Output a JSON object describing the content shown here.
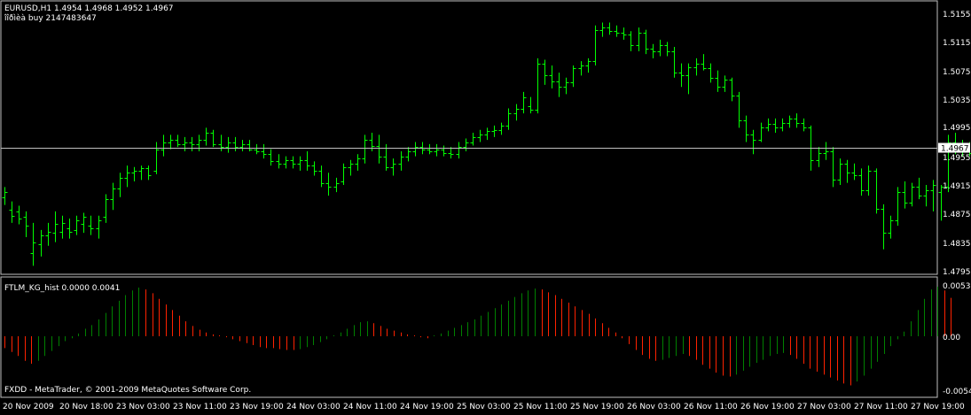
{
  "main_chart": {
    "header": "EURUSD,H1  1.4954 1.4968 1.4952 1.4967",
    "sub_header": "îîðìèà buy 2147483647",
    "current_price": "1.4967",
    "price_axis": [
      "1.5155",
      "1.5115",
      "1.5075",
      "1.5035",
      "1.4995",
      "1.4955",
      "1.4915",
      "1.4875",
      "1.4835",
      "1.4795"
    ]
  },
  "indicator": {
    "header": "FTLM_KG_hist 0.0000 0.0041",
    "axis": [
      "0.0053",
      "0.00",
      "-0.0054"
    ]
  },
  "time_axis": [
    "20 Nov 2009",
    "20 Nov 18:00",
    "23 Nov 03:00",
    "23 Nov 11:00",
    "23 Nov 19:00",
    "24 Nov 03:00",
    "24 Nov 11:00",
    "24 Nov 19:00",
    "25 Nov 03:00",
    "25 Nov 11:00",
    "25 Nov 19:00",
    "26 Nov 03:00",
    "26 Nov 11:00",
    "26 Nov 19:00",
    "27 Nov 03:00",
    "27 Nov 11:00",
    "27 Nov 19:00"
  ],
  "copyright": "FXDD - MetaTrader, © 2001-2009 MetaQuotes Software Corp.",
  "colors": {
    "bull": "#00ff00",
    "bear": "#ff0000",
    "hist_up": "#008000",
    "hist_down": "#ff2200",
    "frame": "#c0c0c0",
    "price_line": "#c0c0c0"
  },
  "chart_data": {
    "type": "candlestick_ohlc",
    "symbol": "EURUSD",
    "timeframe": "H1",
    "price_range": [
      1.478,
      1.517
    ],
    "bars": [
      {
        "o": 1.4898,
        "h": 1.4912,
        "l": 1.4887,
        "c": 1.4905
      },
      {
        "o": 1.488,
        "h": 1.4892,
        "l": 1.4862,
        "c": 1.4872
      },
      {
        "o": 1.4878,
        "h": 1.4886,
        "l": 1.486,
        "c": 1.4868
      },
      {
        "o": 1.487,
        "h": 1.4878,
        "l": 1.4842,
        "c": 1.4858
      },
      {
        "o": 1.482,
        "h": 1.4862,
        "l": 1.4802,
        "c": 1.4835
      },
      {
        "o": 1.4832,
        "h": 1.4852,
        "l": 1.4815,
        "c": 1.4845
      },
      {
        "o": 1.4845,
        "h": 1.4862,
        "l": 1.483,
        "c": 1.485
      },
      {
        "o": 1.4848,
        "h": 1.4878,
        "l": 1.4835,
        "c": 1.486
      },
      {
        "o": 1.485,
        "h": 1.4872,
        "l": 1.484,
        "c": 1.4862
      },
      {
        "o": 1.4855,
        "h": 1.4868,
        "l": 1.484,
        "c": 1.485
      },
      {
        "o": 1.4852,
        "h": 1.4872,
        "l": 1.4845,
        "c": 1.4865
      },
      {
        "o": 1.486,
        "h": 1.4876,
        "l": 1.4848,
        "c": 1.487
      },
      {
        "o": 1.4858,
        "h": 1.4872,
        "l": 1.4845,
        "c": 1.4855
      },
      {
        "o": 1.4855,
        "h": 1.4872,
        "l": 1.484,
        "c": 1.4865
      },
      {
        "o": 1.487,
        "h": 1.4902,
        "l": 1.4862,
        "c": 1.4895
      },
      {
        "o": 1.4895,
        "h": 1.4918,
        "l": 1.488,
        "c": 1.491
      },
      {
        "o": 1.491,
        "h": 1.4932,
        "l": 1.4898,
        "c": 1.4925
      },
      {
        "o": 1.4925,
        "h": 1.4942,
        "l": 1.4912,
        "c": 1.4932
      },
      {
        "o": 1.4932,
        "h": 1.494,
        "l": 1.492,
        "c": 1.4935
      },
      {
        "o": 1.4935,
        "h": 1.4942,
        "l": 1.4922,
        "c": 1.4938
      },
      {
        "o": 1.4938,
        "h": 1.4942,
        "l": 1.4922,
        "c": 1.4928
      },
      {
        "o": 1.4935,
        "h": 1.4975,
        "l": 1.493,
        "c": 1.4965
      },
      {
        "o": 1.4965,
        "h": 1.4985,
        "l": 1.4955,
        "c": 1.4975
      },
      {
        "o": 1.4975,
        "h": 1.4985,
        "l": 1.4965,
        "c": 1.4978
      },
      {
        "o": 1.4978,
        "h": 1.4985,
        "l": 1.4968,
        "c": 1.4972
      },
      {
        "o": 1.4972,
        "h": 1.4982,
        "l": 1.4962,
        "c": 1.4975
      },
      {
        "o": 1.4975,
        "h": 1.4982,
        "l": 1.4962,
        "c": 1.4972
      },
      {
        "o": 1.4972,
        "h": 1.4985,
        "l": 1.4962,
        "c": 1.4978
      },
      {
        "o": 1.4978,
        "h": 1.4995,
        "l": 1.497,
        "c": 1.4988
      },
      {
        "o": 1.4988,
        "h": 1.4992,
        "l": 1.4968,
        "c": 1.4972
      },
      {
        "o": 1.4972,
        "h": 1.4985,
        "l": 1.4962,
        "c": 1.4968
      },
      {
        "o": 1.4968,
        "h": 1.4982,
        "l": 1.496,
        "c": 1.4975
      },
      {
        "o": 1.4975,
        "h": 1.4982,
        "l": 1.4962,
        "c": 1.4968
      },
      {
        "o": 1.4968,
        "h": 1.4978,
        "l": 1.4962,
        "c": 1.4972
      },
      {
        "o": 1.4972,
        "h": 1.4978,
        "l": 1.4962,
        "c": 1.4965
      },
      {
        "o": 1.4965,
        "h": 1.4972,
        "l": 1.4958,
        "c": 1.4962
      },
      {
        "o": 1.4962,
        "h": 1.4972,
        "l": 1.4952,
        "c": 1.4958
      },
      {
        "o": 1.4958,
        "h": 1.4965,
        "l": 1.4942,
        "c": 1.4948
      },
      {
        "o": 1.4948,
        "h": 1.4958,
        "l": 1.4938,
        "c": 1.4945
      },
      {
        "o": 1.4945,
        "h": 1.4955,
        "l": 1.4938,
        "c": 1.495
      },
      {
        "o": 1.495,
        "h": 1.4955,
        "l": 1.4938,
        "c": 1.4945
      },
      {
        "o": 1.4945,
        "h": 1.4955,
        "l": 1.4935,
        "c": 1.495
      },
      {
        "o": 1.495,
        "h": 1.4962,
        "l": 1.4935,
        "c": 1.4942
      },
      {
        "o": 1.4942,
        "h": 1.4948,
        "l": 1.4928,
        "c": 1.4935
      },
      {
        "o": 1.4935,
        "h": 1.4942,
        "l": 1.4912,
        "c": 1.4918
      },
      {
        "o": 1.4918,
        "h": 1.4932,
        "l": 1.49,
        "c": 1.4912
      },
      {
        "o": 1.4912,
        "h": 1.4925,
        "l": 1.4905,
        "c": 1.4918
      },
      {
        "o": 1.492,
        "h": 1.4945,
        "l": 1.4915,
        "c": 1.494
      },
      {
        "o": 1.494,
        "h": 1.495,
        "l": 1.4928,
        "c": 1.4945
      },
      {
        "o": 1.4945,
        "h": 1.4958,
        "l": 1.4935,
        "c": 1.4952
      },
      {
        "o": 1.4952,
        "h": 1.4985,
        "l": 1.4945,
        "c": 1.4978
      },
      {
        "o": 1.4978,
        "h": 1.4988,
        "l": 1.4962,
        "c": 1.497
      },
      {
        "o": 1.497,
        "h": 1.4985,
        "l": 1.4945,
        "c": 1.4955
      },
      {
        "o": 1.4955,
        "h": 1.4972,
        "l": 1.4935,
        "c": 1.494
      },
      {
        "o": 1.494,
        "h": 1.4952,
        "l": 1.4928,
        "c": 1.4945
      },
      {
        "o": 1.4945,
        "h": 1.4962,
        "l": 1.4935,
        "c": 1.4955
      },
      {
        "o": 1.4955,
        "h": 1.4968,
        "l": 1.4948,
        "c": 1.4962
      },
      {
        "o": 1.4962,
        "h": 1.4975,
        "l": 1.4955,
        "c": 1.4968
      },
      {
        "o": 1.4968,
        "h": 1.4975,
        "l": 1.4958,
        "c": 1.4965
      },
      {
        "o": 1.4965,
        "h": 1.4972,
        "l": 1.4958,
        "c": 1.4962
      },
      {
        "o": 1.4962,
        "h": 1.4972,
        "l": 1.4955,
        "c": 1.4965
      },
      {
        "o": 1.4965,
        "h": 1.497,
        "l": 1.4955,
        "c": 1.496
      },
      {
        "o": 1.496,
        "h": 1.4968,
        "l": 1.4952,
        "c": 1.4958
      },
      {
        "o": 1.4958,
        "h": 1.4975,
        "l": 1.4952,
        "c": 1.4968
      },
      {
        "o": 1.4968,
        "h": 1.498,
        "l": 1.4962,
        "c": 1.4975
      },
      {
        "o": 1.4975,
        "h": 1.4988,
        "l": 1.497,
        "c": 1.4982
      },
      {
        "o": 1.4982,
        "h": 1.4992,
        "l": 1.4975,
        "c": 1.4985
      },
      {
        "o": 1.4985,
        "h": 1.4995,
        "l": 1.4978,
        "c": 1.499
      },
      {
        "o": 1.499,
        "h": 1.4998,
        "l": 1.4982,
        "c": 1.4992
      },
      {
        "o": 1.4992,
        "h": 1.5002,
        "l": 1.4985,
        "c": 1.4998
      },
      {
        "o": 1.4998,
        "h": 1.5022,
        "l": 1.4992,
        "c": 1.5015
      },
      {
        "o": 1.5015,
        "h": 1.5028,
        "l": 1.5005,
        "c": 1.5022
      },
      {
        "o": 1.5022,
        "h": 1.5045,
        "l": 1.5015,
        "c": 1.5038
      },
      {
        "o": 1.5025,
        "h": 1.5038,
        "l": 1.5015,
        "c": 1.502
      },
      {
        "o": 1.502,
        "h": 1.5092,
        "l": 1.5015,
        "c": 1.5085
      },
      {
        "o": 1.5085,
        "h": 1.509,
        "l": 1.5055,
        "c": 1.5068
      },
      {
        "o": 1.5068,
        "h": 1.5082,
        "l": 1.505,
        "c": 1.506
      },
      {
        "o": 1.506,
        "h": 1.5072,
        "l": 1.5038,
        "c": 1.5052
      },
      {
        "o": 1.5052,
        "h": 1.5065,
        "l": 1.5042,
        "c": 1.5058
      },
      {
        "o": 1.5058,
        "h": 1.5082,
        "l": 1.5052,
        "c": 1.5078
      },
      {
        "o": 1.5078,
        "h": 1.5088,
        "l": 1.5068,
        "c": 1.5082
      },
      {
        "o": 1.5082,
        "h": 1.5092,
        "l": 1.5072,
        "c": 1.5088
      },
      {
        "o": 1.5088,
        "h": 1.5138,
        "l": 1.5082,
        "c": 1.5132
      },
      {
        "o": 1.5132,
        "h": 1.5142,
        "l": 1.5122,
        "c": 1.5135
      },
      {
        "o": 1.5135,
        "h": 1.5142,
        "l": 1.5125,
        "c": 1.513
      },
      {
        "o": 1.513,
        "h": 1.5138,
        "l": 1.5122,
        "c": 1.5128
      },
      {
        "o": 1.5128,
        "h": 1.5135,
        "l": 1.5118,
        "c": 1.5125
      },
      {
        "o": 1.5125,
        "h": 1.513,
        "l": 1.5102,
        "c": 1.511
      },
      {
        "o": 1.511,
        "h": 1.5135,
        "l": 1.5102,
        "c": 1.5128
      },
      {
        "o": 1.5128,
        "h": 1.5132,
        "l": 1.5098,
        "c": 1.5105
      },
      {
        "o": 1.5105,
        "h": 1.5112,
        "l": 1.5092,
        "c": 1.5102
      },
      {
        "o": 1.5102,
        "h": 1.5118,
        "l": 1.5095,
        "c": 1.511
      },
      {
        "o": 1.511,
        "h": 1.5115,
        "l": 1.5095,
        "c": 1.5102
      },
      {
        "o": 1.5102,
        "h": 1.5108,
        "l": 1.5065,
        "c": 1.5072
      },
      {
        "o": 1.5072,
        "h": 1.5085,
        "l": 1.5052,
        "c": 1.5068
      },
      {
        "o": 1.5068,
        "h": 1.5085,
        "l": 1.5042,
        "c": 1.508
      },
      {
        "o": 1.508,
        "h": 1.5092,
        "l": 1.5068,
        "c": 1.5085
      },
      {
        "o": 1.5085,
        "h": 1.5098,
        "l": 1.5075,
        "c": 1.5078
      },
      {
        "o": 1.5078,
        "h": 1.5085,
        "l": 1.5058,
        "c": 1.5065
      },
      {
        "o": 1.5065,
        "h": 1.5075,
        "l": 1.5045,
        "c": 1.5052
      },
      {
        "o": 1.5052,
        "h": 1.5068,
        "l": 1.5045,
        "c": 1.5062
      },
      {
        "o": 1.5062,
        "h": 1.5065,
        "l": 1.5032,
        "c": 1.504
      },
      {
        "o": 1.504,
        "h": 1.5045,
        "l": 1.4995,
        "c": 1.5005
      },
      {
        "o": 1.5005,
        "h": 1.5012,
        "l": 1.4975,
        "c": 1.4985
      },
      {
        "o": 1.4985,
        "h": 1.4992,
        "l": 1.4958,
        "c": 1.4978
      },
      {
        "o": 1.4978,
        "h": 1.5002,
        "l": 1.4975,
        "c": 1.4995
      },
      {
        "o": 1.4995,
        "h": 1.5008,
        "l": 1.499,
        "c": 1.5
      },
      {
        "o": 1.5,
        "h": 1.5008,
        "l": 1.4988,
        "c": 1.4995
      },
      {
        "o": 1.4995,
        "h": 1.5008,
        "l": 1.499,
        "c": 1.5002
      },
      {
        "o": 1.5002,
        "h": 1.5012,
        "l": 1.4995,
        "c": 1.5008
      },
      {
        "o": 1.5008,
        "h": 1.5015,
        "l": 1.4995,
        "c": 1.5002
      },
      {
        "o": 1.5002,
        "h": 1.5008,
        "l": 1.499,
        "c": 1.4995
      },
      {
        "o": 1.4995,
        "h": 1.4998,
        "l": 1.4935,
        "c": 1.495
      },
      {
        "o": 1.495,
        "h": 1.4968,
        "l": 1.494,
        "c": 1.496
      },
      {
        "o": 1.496,
        "h": 1.4975,
        "l": 1.495,
        "c": 1.4962
      },
      {
        "o": 1.4962,
        "h": 1.4968,
        "l": 1.4912,
        "c": 1.4922
      },
      {
        "o": 1.4922,
        "h": 1.4952,
        "l": 1.4915,
        "c": 1.4945
      },
      {
        "o": 1.4945,
        "h": 1.495,
        "l": 1.4918,
        "c": 1.4932
      },
      {
        "o": 1.4932,
        "h": 1.4945,
        "l": 1.4922,
        "c": 1.4928
      },
      {
        "o": 1.4928,
        "h": 1.4938,
        "l": 1.49,
        "c": 1.4908
      },
      {
        "o": 1.4908,
        "h": 1.4942,
        "l": 1.49,
        "c": 1.4935
      },
      {
        "o": 1.4935,
        "h": 1.4938,
        "l": 1.4875,
        "c": 1.4882
      },
      {
        "o": 1.4882,
        "h": 1.4888,
        "l": 1.4825,
        "c": 1.4848
      },
      {
        "o": 1.4848,
        "h": 1.4872,
        "l": 1.484,
        "c": 1.4865
      },
      {
        "o": 1.4865,
        "h": 1.4912,
        "l": 1.4858,
        "c": 1.4905
      },
      {
        "o": 1.4905,
        "h": 1.492,
        "l": 1.4882,
        "c": 1.489
      },
      {
        "o": 1.489,
        "h": 1.4918,
        "l": 1.4885,
        "c": 1.4912
      },
      {
        "o": 1.4912,
        "h": 1.4925,
        "l": 1.4895,
        "c": 1.49
      },
      {
        "o": 1.49,
        "h": 1.4915,
        "l": 1.4885,
        "c": 1.4908
      },
      {
        "o": 1.4908,
        "h": 1.4922,
        "l": 1.4878,
        "c": 1.4915
      },
      {
        "o": 1.4905,
        "h": 1.4915,
        "l": 1.4865,
        "c": 1.4912
      },
      {
        "o": 1.4912,
        "h": 1.4985,
        "l": 1.4905,
        "c": 1.4975
      },
      {
        "o": 1.4975,
        "h": 1.4988,
        "l": 1.4958,
        "c": 1.4962
      },
      {
        "o": 1.4962,
        "h": 1.4978,
        "l": 1.4955,
        "c": 1.4968
      },
      {
        "o": 1.4968,
        "h": 1.4975,
        "l": 1.4955,
        "c": 1.496
      },
      {
        "o": 1.496,
        "h": 1.4968,
        "l": 1.495,
        "c": 1.4958
      },
      {
        "o": 1.4954,
        "h": 1.4968,
        "l": 1.4952,
        "c": 1.4967
      }
    ],
    "histogram": {
      "range": [
        -0.0054,
        0.0053
      ],
      "values": [
        -0.0012,
        -0.0016,
        -0.002,
        -0.0025,
        -0.0028,
        -0.0025,
        -0.002,
        -0.0015,
        -0.001,
        -0.0005,
        -0.0002,
        0.0003,
        0.0008,
        0.0012,
        0.0018,
        0.0025,
        0.0032,
        0.0038,
        0.0044,
        0.0049,
        0.0052,
        0.005,
        0.0046,
        0.004,
        0.0034,
        0.0028,
        0.0022,
        0.0016,
        0.0011,
        0.0007,
        0.0004,
        0.0002,
        0.0001,
        -0.0001,
        -0.0003,
        -0.0005,
        -0.0007,
        -0.0009,
        -0.0011,
        -0.0012,
        -0.0012,
        -0.0013,
        -0.0014,
        -0.0014,
        -0.0013,
        -0.0011,
        -0.0009,
        -0.0006,
        -0.0003,
        0.0001,
        0.0004,
        0.0008,
        0.0012,
        0.0015,
        0.0016,
        0.0014,
        0.0011,
        0.0008,
        0.0006,
        0.0004,
        0.0002,
        0.0001,
        -0.0001,
        -0.0002,
        0.0001,
        0.0003,
        0.0006,
        0.0009,
        0.0012,
        0.0015,
        0.0018,
        0.0022,
        0.0026,
        0.003,
        0.0034,
        0.0038,
        0.0042,
        0.0046,
        0.0049,
        0.0051,
        0.005,
        0.0047,
        0.0044,
        0.004,
        0.0036,
        0.0032,
        0.0028,
        0.0024,
        0.0019,
        0.0014,
        0.0009,
        0.0004,
        -0.0002,
        -0.0008,
        -0.0014,
        -0.0019,
        -0.0023,
        -0.0025,
        -0.0024,
        -0.0022,
        -0.002,
        -0.0018,
        -0.002,
        -0.0024,
        -0.0029,
        -0.0033,
        -0.0037,
        -0.004,
        -0.0041,
        -0.0039,
        -0.0035,
        -0.0031,
        -0.0027,
        -0.0024,
        -0.002,
        -0.0018,
        -0.0017,
        -0.0019,
        -0.0023,
        -0.0028,
        -0.0033,
        -0.0036,
        -0.0039,
        -0.0042,
        -0.0045,
        -0.0048,
        -0.005,
        -0.0046,
        -0.004,
        -0.0033,
        -0.0026,
        -0.0018,
        -0.001,
        -0.0003,
        0.0005,
        0.0016,
        0.0028,
        0.004,
        0.005,
        0.0053,
        0.0049,
        0.0041
      ]
    }
  }
}
